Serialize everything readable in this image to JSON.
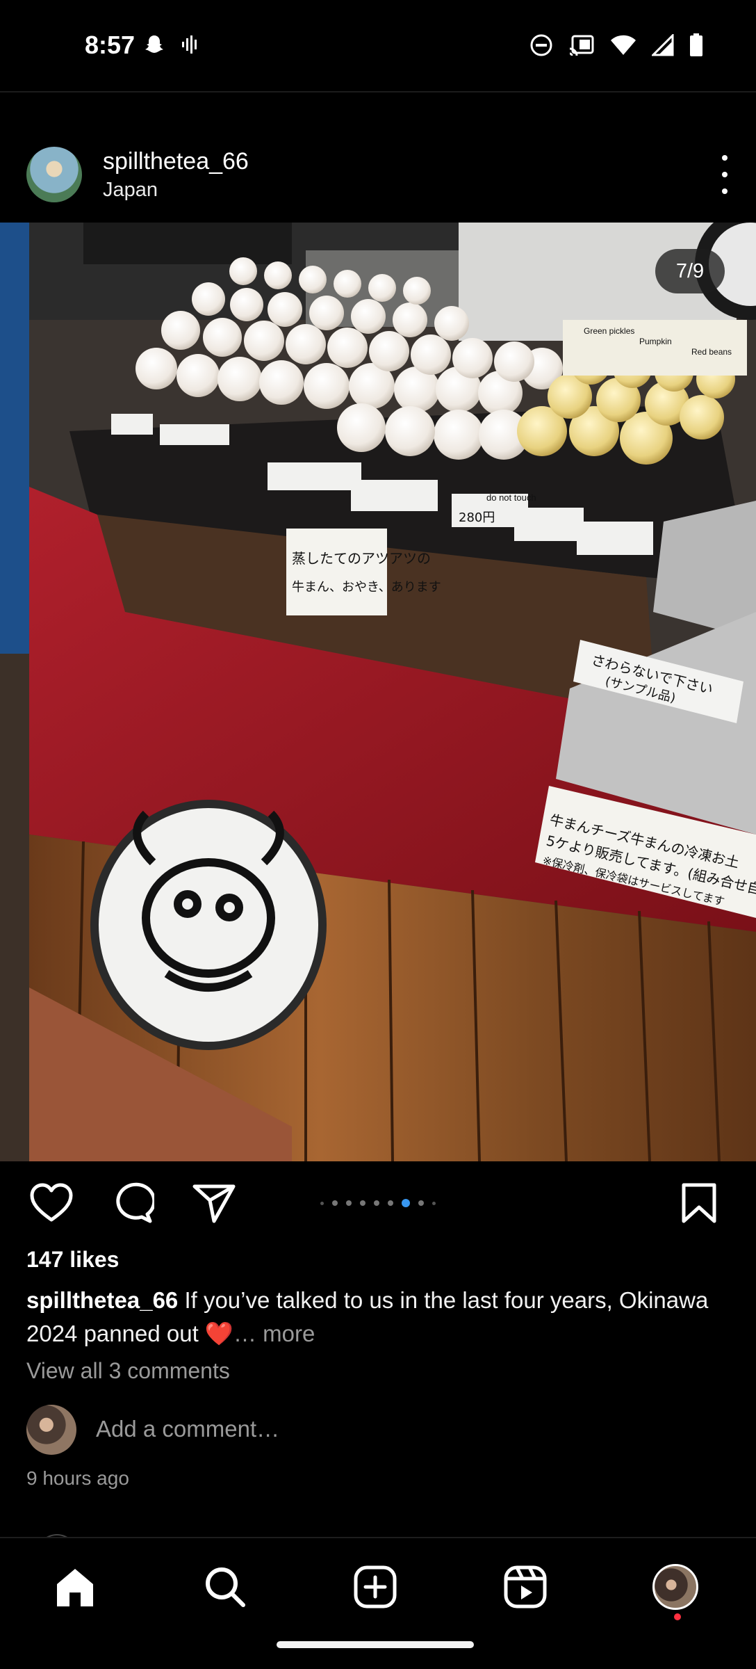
{
  "status_bar": {
    "time": "8:57",
    "icons_left": [
      "snapchat-icon",
      "voicemail-icon"
    ],
    "icons_right": [
      "dnd-icon",
      "cast-icon",
      "wifi-icon",
      "signal-icon",
      "battery-icon"
    ]
  },
  "post": {
    "username": "spillthetea_66",
    "location": "Japan",
    "image_counter": "7/9",
    "carousel": {
      "total": 9,
      "active_index": 6
    },
    "likes": "147 likes",
    "caption_user": "spillthetea_66",
    "caption_text": " If you’ve talked to us in the last four years, Okinawa 2024 panned out ❤️",
    "caption_more": "… more",
    "view_comments": "View all 3 comments",
    "add_comment_placeholder": "Add a comment…",
    "time_ago": "9 hours ago"
  },
  "photo_signs": {
    "steamed_sign": [
      "蒸したてのアツアツの",
      "牛まん、おやき、あります"
    ],
    "chilled_sign": [
      "牛まんチーズ牛まんの冷凍お土",
      "5ケより販売してます。(組み合せ自",
      "※保冷剤、保冷袋はサービスしてます"
    ],
    "sample_sign": [
      "さわらないで下さい",
      "(サンプル品)"
    ],
    "pumpkin_label": "Pumpkin",
    "red_beans_label": "Red beans",
    "green_pickles_label": "Green pickles",
    "do_not_touch": "do not touch",
    "price": "280円"
  },
  "nav": {
    "items": [
      "home-icon",
      "search-icon",
      "create-icon",
      "reels-icon",
      "profile-avatar"
    ]
  },
  "colors": {
    "background": "#000000",
    "accent_blue": "#3897f0",
    "notification_red": "#ff3040",
    "muted_text": "#9a9a9a"
  }
}
